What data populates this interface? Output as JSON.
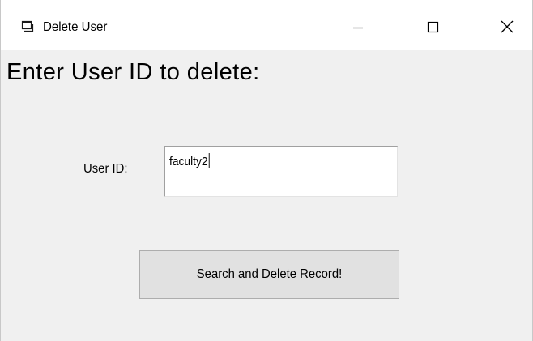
{
  "window": {
    "title": "Delete User",
    "icon": "app-window-icon",
    "controls": {
      "minimize_icon": "minimize-icon",
      "maximize_icon": "maximize-icon",
      "close_icon": "close-icon"
    }
  },
  "form": {
    "heading": "Enter User ID to delete:",
    "user_id_label": "User ID:",
    "user_id_value": "faculty2",
    "submit_label": "Search and Delete Record!"
  },
  "colors": {
    "client_background": "#f0f0f0",
    "titlebar_background": "#ffffff",
    "button_face": "#e1e1e1",
    "button_border": "#adadad",
    "input_background": "#ffffff"
  }
}
